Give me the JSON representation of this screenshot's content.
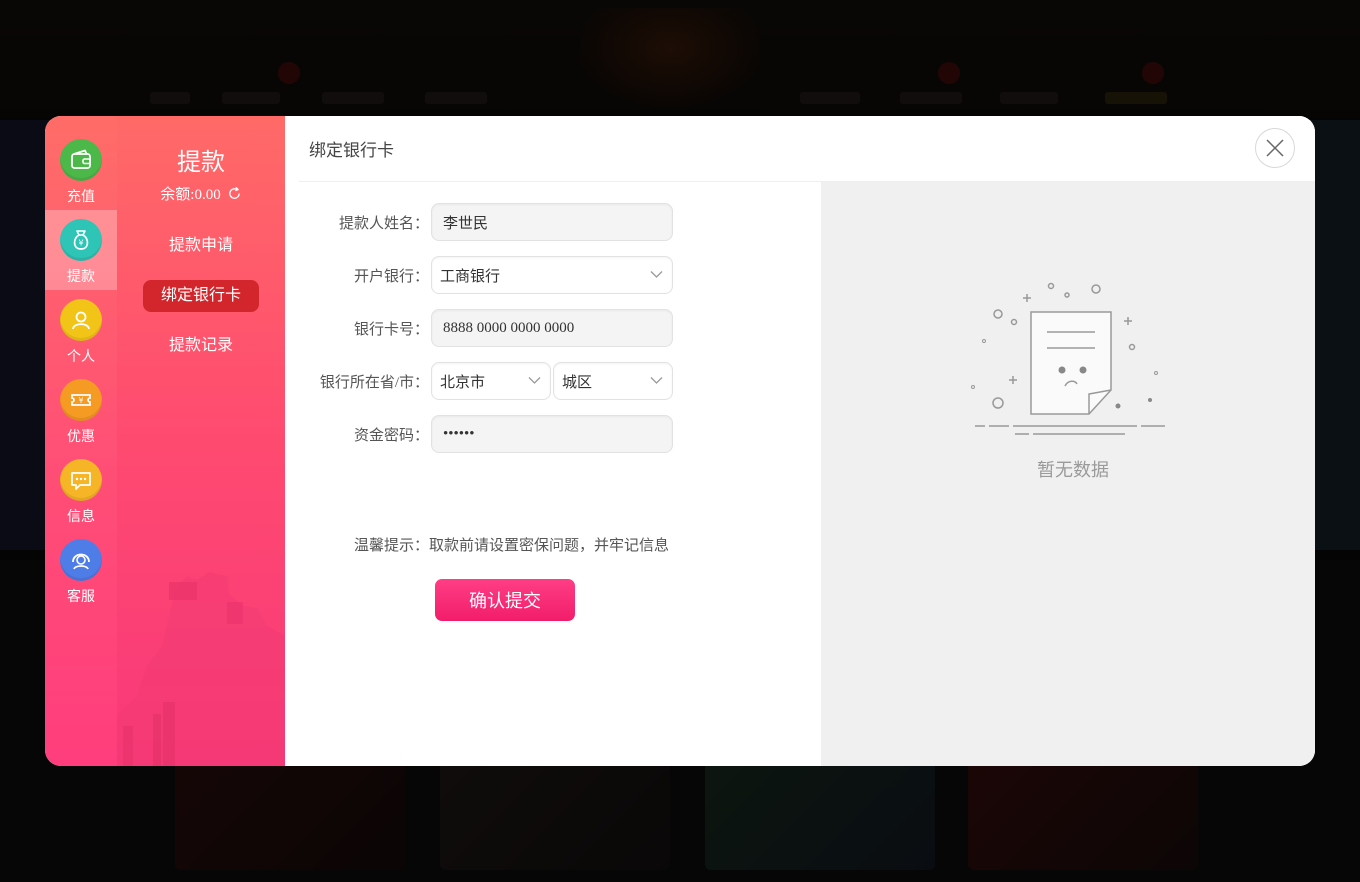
{
  "sidebar": {
    "items": [
      {
        "label": "充值",
        "icon": "wallet-icon",
        "color": "#4cb84a"
      },
      {
        "label": "提款",
        "icon": "money-bag-icon",
        "color": "#2ec4b6",
        "active": true
      },
      {
        "label": "个人",
        "icon": "user-icon",
        "color": "#f2c418"
      },
      {
        "label": "优惠",
        "icon": "ticket-icon",
        "color": "#f59a23"
      },
      {
        "label": "信息",
        "icon": "chat-icon",
        "color": "#f5b526"
      },
      {
        "label": "客服",
        "icon": "headset-icon",
        "color": "#4f7de8"
      }
    ]
  },
  "subnav": {
    "title": "提款",
    "balance": "余额:0.00",
    "items": [
      {
        "label": "提款申请"
      },
      {
        "label": "绑定银行卡",
        "active": true
      },
      {
        "label": "提款记录"
      }
    ]
  },
  "content": {
    "title": "绑定银行卡",
    "form": {
      "name_label": "提款人姓名：",
      "name_value": "李世民",
      "bank_label": "开户银行：",
      "bank_value": "工商银行",
      "card_label": "银行卡号：",
      "card_value": "8888 0000 0000 0000",
      "region_label": "银行所在省/市：",
      "province_value": "北京市",
      "city_value": "城区",
      "password_label": "资金密码：",
      "password_value": "••••••",
      "hint": "温馨提示：取款前请设置密保问题，并牢记信息",
      "submit_label": "确认提交"
    },
    "empty_text": "暂无数据"
  },
  "colors": {
    "accent": "#ff3d7d",
    "active_tab": "#d2262c",
    "submit": "#f21d6a"
  }
}
